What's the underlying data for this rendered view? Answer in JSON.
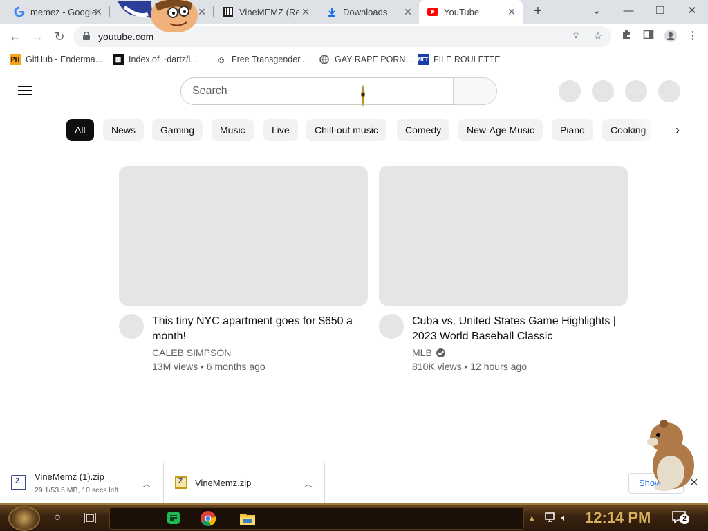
{
  "browser": {
    "tabs": [
      {
        "title": "memez - Google",
        "icon": "google-icon"
      },
      {
        "title": "VineMEMZ (Re",
        "icon": "columns-icon"
      },
      {
        "title": "Downloads",
        "icon": "download-icon"
      },
      {
        "title": "YouTube",
        "icon": "youtube-icon",
        "active": true
      }
    ],
    "url": "youtube.com",
    "bookmarks": [
      {
        "label": "GitHub - Enderma...",
        "icon": "ph-icon"
      },
      {
        "label": "Index of ~dartz/i...",
        "icon": "qr-icon"
      },
      {
        "label": "Free Transgender...",
        "icon": "mask-icon"
      },
      {
        "label": "GAY RAPE PORN...",
        "icon": "globe-icon"
      },
      {
        "label": "FILE ROULETTE",
        "icon": "mft-icon"
      }
    ]
  },
  "youtube": {
    "search_placeholder": "Search",
    "chips": [
      "All",
      "News",
      "Gaming",
      "Music",
      "Live",
      "Chill-out music",
      "Comedy",
      "New-Age Music",
      "Piano",
      "Cooking"
    ],
    "videos": [
      {
        "title": "This tiny NYC apartment goes for $650 a month!",
        "channel": "CALEB SIMPSON",
        "meta": "13M views • 6 months ago",
        "verified": false
      },
      {
        "title": "Cuba vs. United States Game Highlights | 2023 World Baseball Classic",
        "channel": "MLB",
        "meta": "810K views • 12 hours ago",
        "verified": true
      }
    ]
  },
  "downloads": [
    {
      "name": "VineMemz (1).zip",
      "status": "29.1/53.5 MB, 10 secs left"
    },
    {
      "name": "VineMemz.zip",
      "status": ""
    }
  ],
  "downloads_show_all": "Show",
  "taskbar": {
    "clock": "12:14 PM",
    "notification_count": "2"
  },
  "colors": {
    "accent_youtube": "#ff0000",
    "chip_selected": "#0f0f0f",
    "placeholder_gray": "#e5e5e5",
    "clock": "#d8b25a"
  }
}
